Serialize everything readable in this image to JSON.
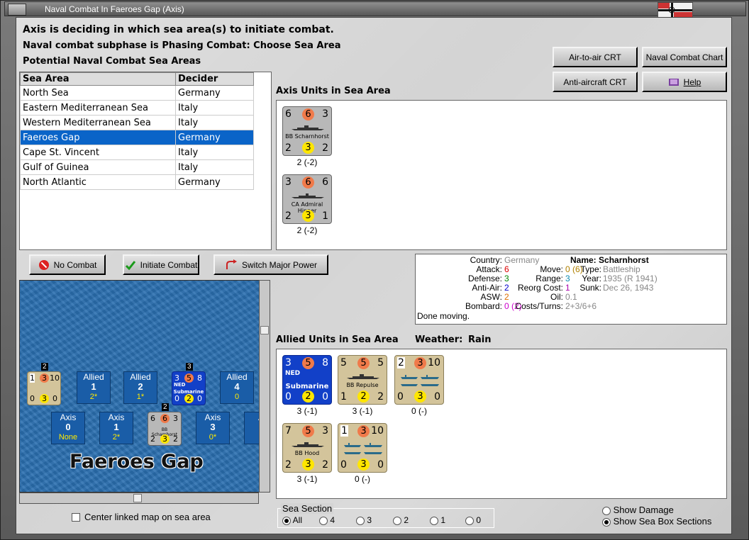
{
  "window": {
    "title": "Naval Combat In Faeroes Gap (Axis)"
  },
  "header": {
    "line1": "Axis is deciding in which sea area(s) to initiate combat.",
    "line2": "Naval combat subphase is Phasing Combat: Choose Sea Area",
    "line3": "Potential Naval Combat Sea Areas"
  },
  "buttons": {
    "air_to_air": "Air-to-air CRT",
    "naval_chart": "Naval Combat Chart",
    "anti_aircraft": "Anti-aircraft CRT",
    "help": "Help",
    "no_combat": "No Combat",
    "initiate": "Initiate Combat",
    "switch": "Switch Major Power"
  },
  "table": {
    "headers": [
      "Sea Area",
      "Decider"
    ],
    "rows": [
      [
        "North Sea",
        "Germany"
      ],
      [
        "Eastern Mediterranean Sea",
        "Italy"
      ],
      [
        "Western Mediterranean Sea",
        "Italy"
      ],
      [
        "Faeroes Gap",
        "Germany"
      ],
      [
        "Cape St. Vincent",
        "Italy"
      ],
      [
        "Gulf of Guinea",
        "Italy"
      ],
      [
        "North Atlantic",
        "Germany"
      ]
    ],
    "selected_index": 3
  },
  "axis_units": {
    "title": "Axis Units in Sea Area",
    "units": [
      {
        "name": "BB Scharnhorst",
        "tl": "6",
        "tc": "6",
        "tr": "3",
        "bl": "2",
        "bc": "3",
        "br": "2",
        "below": "2 (-2)"
      },
      {
        "name": "CA Admiral Hipper",
        "tl": "3",
        "tc": "6",
        "tr": "6",
        "bl": "2",
        "bc": "3",
        "br": "1",
        "below": "2 (-2)"
      }
    ]
  },
  "info": {
    "country_label": "Country:",
    "country": "Germany",
    "attack_label": "Attack:",
    "attack": "6",
    "defense_label": "Defense:",
    "defense": "3",
    "antiair_label": "Anti-Air:",
    "antiair": "2",
    "asw_label": "ASW:",
    "asw": "2",
    "bombard_label": "Bombard:",
    "bombard": "0 (2)",
    "done": "Done moving.",
    "name_label": "Name:",
    "name": "Scharnhorst",
    "move_label": "Move:",
    "move": "0",
    "move_paren": "(6)",
    "range_label": "Range:",
    "range": "3",
    "reorg_label": "Reorg Cost:",
    "reorg": "1",
    "oil_label": "Oil:",
    "oil": "0.1",
    "costs_label": "Costs/Turns:",
    "costs": "2+3/6+6",
    "type_label": "Type:",
    "type": "Battleship",
    "year_label": "Year:",
    "year": "1935 (R 1941)",
    "sunk_label": "Sunk:",
    "sunk": "Dec 26, 1943"
  },
  "allied_units": {
    "title": "Allied Units in Sea Area",
    "weather_label": "Weather:",
    "weather": "Rain",
    "units": [
      {
        "name": "Submarine",
        "nation": "NED",
        "style": "blue",
        "tl": "3",
        "tc": "5",
        "tr": "8",
        "bl": "0",
        "bc": "2",
        "br": "0",
        "below": "3 (-1)"
      },
      {
        "name": "BB Repulse",
        "style": "tan",
        "tl": "5",
        "tc": "5",
        "tr": "5",
        "bl": "1",
        "bc": "2",
        "br": "2",
        "below": "3 (-1)"
      },
      {
        "name": "",
        "style": "tan",
        "tl": "2",
        "tc": "3",
        "tr": "10",
        "bl": "0",
        "bc": "3",
        "br": "0",
        "below": "0 (-)"
      },
      {
        "name": "BB Hood",
        "style": "tan",
        "tl": "7",
        "tc": "5",
        "tr": "3",
        "bl": "2",
        "bc": "3",
        "br": "2",
        "below": "3 (-1)"
      },
      {
        "name": "",
        "style": "tan",
        "tl": "1",
        "tc": "3",
        "tr": "10",
        "bl": "0",
        "bc": "3",
        "br": "0",
        "below": "0 (-)"
      }
    ]
  },
  "map": {
    "sea_name": "Faeroes Gap",
    "allied_boxes": [
      {
        "label": "Allied",
        "num": "1",
        "val": "2*"
      },
      {
        "label": "Allied",
        "num": "2",
        "val": "1*"
      },
      {
        "label": "Allied",
        "num": "4",
        "val": "0"
      }
    ],
    "axis_boxes": [
      {
        "label": "Axis",
        "num": "0",
        "val": "None"
      },
      {
        "label": "Axis",
        "num": "1",
        "val": "2*"
      },
      {
        "label": "Axis",
        "num": "3",
        "val": "0*"
      },
      {
        "label": "A",
        "num": "",
        "val": ""
      }
    ],
    "stack_counts": [
      "2",
      "3",
      "2"
    ],
    "counter_name": "BB Scharnhorst",
    "sub_label": "Submarine",
    "sub_nation": "NED",
    "mini_a": {
      "tl": "1",
      "tc": "3",
      "tr": "10",
      "bl": "0",
      "bc": "3",
      "br": "0"
    },
    "mini_sub": {
      "tl": "3",
      "tc": "5",
      "tr": "8",
      "bl": "0",
      "bc": "2",
      "br": "0"
    },
    "mini_bb": {
      "tl": "6",
      "tc": "6",
      "tr": "3",
      "bl": "2",
      "bc": "3",
      "br": "2"
    }
  },
  "center_linked": "Center linked map on sea area",
  "sea_section": {
    "label": "Sea Section",
    "options": [
      "All",
      "4",
      "3",
      "2",
      "1",
      "0"
    ],
    "selected": "All"
  },
  "display": {
    "show_damage": "Show Damage",
    "show_sections": "Show Sea Box Sections",
    "selected": "Show Sea Box Sections"
  }
}
